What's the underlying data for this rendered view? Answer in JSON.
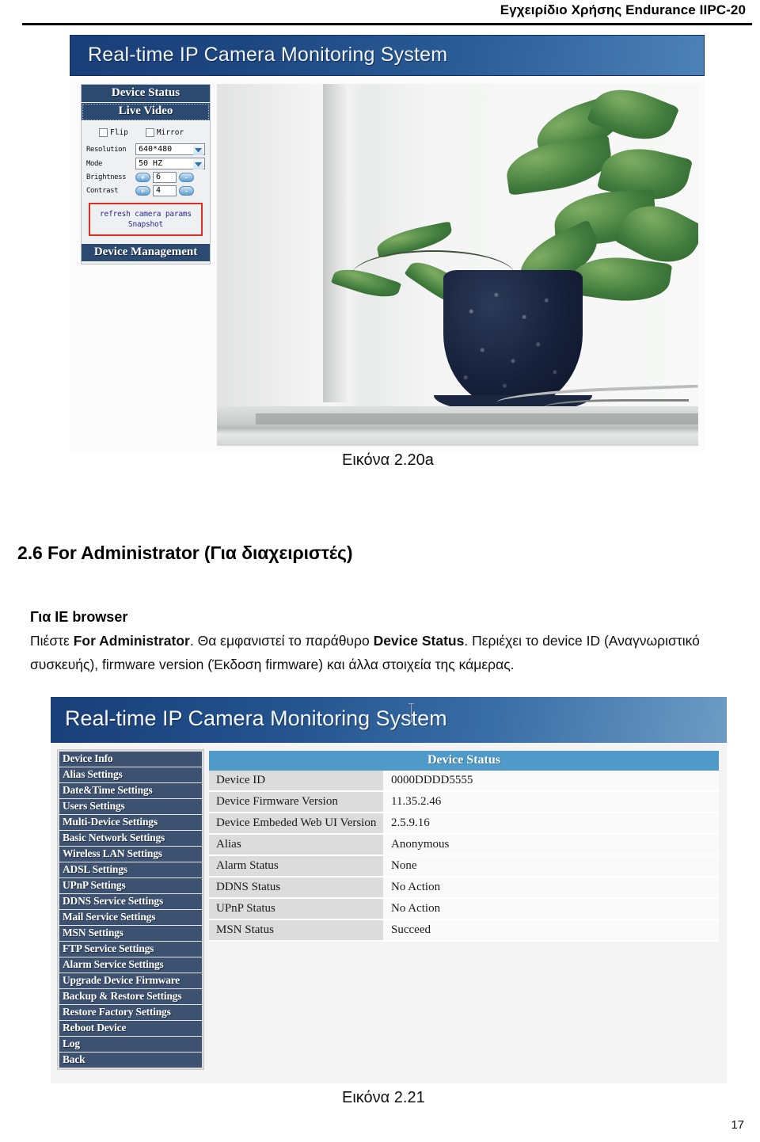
{
  "document": {
    "running_header": "Εγχειρίδιο Χρήσης Endurance IIPC-20",
    "page_number": "17"
  },
  "figure_top": {
    "caption": "Εικόνα 2.20a",
    "app_title": "Real-time IP Camera Monitoring System",
    "nav": {
      "device_status": "Device Status",
      "live_video": "Live Video",
      "device_management": "Device Management"
    },
    "checkboxes": [
      {
        "label": "Flip",
        "checked": false
      },
      {
        "label": "Mirror",
        "checked": false
      }
    ],
    "fields": [
      {
        "label": "Resolution",
        "value": "640*480",
        "type": "select"
      },
      {
        "label": "Mode",
        "value": "50 HZ",
        "type": "select"
      },
      {
        "label": "Brightness",
        "value": "6",
        "type": "spinner"
      },
      {
        "label": "Contrast",
        "value": "4",
        "type": "spinner"
      }
    ],
    "links": [
      "refresh camera params",
      "Snapshot"
    ],
    "plus_label": "+",
    "minus_label": "-"
  },
  "section": {
    "heading": "2.6 For Administrator (Για διαχειριστές)",
    "subheading": "Για IE browser",
    "paragraph_pre": "Πιέστε ",
    "paragraph_b1": "For Administrator",
    "paragraph_mid": ". Θα εμφανιστεί το παράθυρο ",
    "paragraph_b2": "Device Status",
    "paragraph_post": ". Περιέχει το device ID (Αναγνωριστικό συσκευής), firmware version (Έκδοση firmware) και άλλα στοιχεία της κάμερας."
  },
  "figure_bottom": {
    "caption": "Εικόνα 2.21",
    "app_title": "Real-time IP Camera Monitoring System",
    "menu_items": [
      "Device Info",
      "Alias Settings",
      "Date&Time Settings",
      "Users Settings",
      "Multi-Device Settings",
      "Basic Network Settings",
      "Wireless LAN Settings",
      "ADSL Settings",
      "UPnP Settings",
      "DDNS Service Settings",
      "Mail Service Settings",
      "MSN Settings",
      "FTP Service Settings",
      "Alarm Service Settings",
      "Upgrade Device Firmware",
      "Backup & Restore Settings",
      "Restore Factory Settings",
      "Reboot Device",
      "Log",
      "Back"
    ],
    "status_title": "Device Status",
    "status_rows": [
      {
        "key": "Device ID",
        "value": "0000DDDD5555"
      },
      {
        "key": "Device Firmware Version",
        "value": "11.35.2.46"
      },
      {
        "key": "Device Embeded Web UI Version",
        "value": "2.5.9.16"
      },
      {
        "key": "Alias",
        "value": "Anonymous"
      },
      {
        "key": "Alarm Status",
        "value": "None"
      },
      {
        "key": "DDNS Status",
        "value": "No Action"
      },
      {
        "key": "UPnP Status",
        "value": "No Action"
      },
      {
        "key": "MSN Status",
        "value": "Succeed"
      }
    ]
  },
  "colors": {
    "title_bar_dark": "#1a3f79",
    "nav_band": "#2c4a70",
    "menu_item": "#3c5270",
    "status_header": "#4f9ac8",
    "red_box": "#e02a22",
    "link_blue": "#2b2b8f"
  }
}
